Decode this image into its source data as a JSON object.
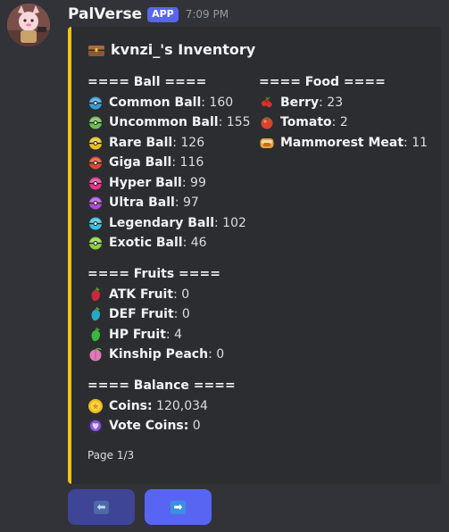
{
  "header": {
    "username": "PalVerse",
    "badge": "APP",
    "timestamp": "7:09 PM"
  },
  "embed": {
    "accent_color": "#f1c40f",
    "title_icon": "chest-icon",
    "title": "kvnzi_'s Inventory",
    "ball_section": {
      "title": "==== Ball ====",
      "items": [
        {
          "name": "Common Ball",
          "value": "160",
          "icon": "common-ball-icon",
          "color": "#3a9bd6"
        },
        {
          "name": "Uncommon Ball",
          "value": "155",
          "icon": "uncommon-ball-icon",
          "color": "#6cc04a"
        },
        {
          "name": "Rare Ball",
          "value": "126",
          "icon": "rare-ball-icon",
          "color": "#e9c21a"
        },
        {
          "name": "Giga Ball",
          "value": "116",
          "icon": "giga-ball-icon",
          "color": "#e0492a"
        },
        {
          "name": "Hyper Ball",
          "value": "99",
          "icon": "hyper-ball-icon",
          "color": "#e8338a"
        },
        {
          "name": "Ultra Ball",
          "value": "97",
          "icon": "ultra-ball-icon",
          "color": "#b14ad8"
        },
        {
          "name": "Legendary Ball",
          "value": "102",
          "icon": "legendary-ball-icon",
          "color": "#3cc0e0"
        },
        {
          "name": "Exotic Ball",
          "value": "46",
          "icon": "exotic-ball-icon",
          "color": "#8cd23c"
        }
      ]
    },
    "food_section": {
      "title": "==== Food ====",
      "items": [
        {
          "name": "Berry",
          "value": "23",
          "icon": "berry-icon",
          "color": "#d0342c"
        },
        {
          "name": "Tomato",
          "value": "2",
          "icon": "tomato-icon",
          "color": "#d8432a"
        },
        {
          "name": "Mammorest Meat",
          "value": "11",
          "icon": "mammorest-meat-icon",
          "color": "#e8a340"
        }
      ]
    },
    "fruits_section": {
      "title": "==== Fruits ====",
      "items": [
        {
          "name": "ATK Fruit",
          "value": "0",
          "icon": "atk-fruit-icon",
          "color": "#c8283a"
        },
        {
          "name": "DEF Fruit",
          "value": "0",
          "icon": "def-fruit-icon",
          "color": "#2aa6c8"
        },
        {
          "name": "HP Fruit",
          "value": "4",
          "icon": "hp-fruit-icon",
          "color": "#3ab83a"
        },
        {
          "name": "Kinship Peach",
          "value": "0",
          "icon": "kinship-peach-icon",
          "color": "#e07ab8"
        }
      ]
    },
    "balance_section": {
      "title": "==== Balance ====",
      "items": [
        {
          "name": "Coins:",
          "value": "120,034",
          "icon": "coin-icon",
          "color": "#f2b81a"
        },
        {
          "name": "Vote Coins:",
          "value": "0",
          "icon": "vote-coin-icon",
          "color": "#8a5ad8"
        }
      ]
    },
    "footer": "Page 1/3"
  },
  "buttons": {
    "prev": {
      "glyph": "⬅",
      "icon": "left-arrow-icon"
    },
    "next": {
      "glyph": "➡",
      "icon": "right-arrow-icon"
    }
  }
}
